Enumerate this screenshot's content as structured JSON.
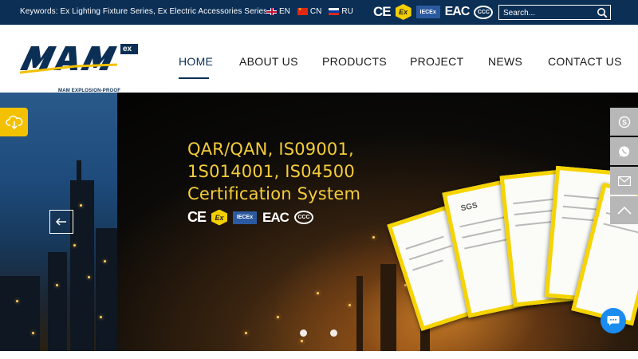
{
  "topbar": {
    "keywords": "Keywords: Ex Lighting Fixture Series, Ex Electric Accessories Series",
    "languages": [
      {
        "code": "EN",
        "flag": "uk-flag-icon"
      },
      {
        "code": "CN",
        "flag": "china-flag-icon"
      },
      {
        "code": "RU",
        "flag": "russia-flag-icon"
      }
    ],
    "certs": {
      "ce": "CE",
      "ex": "Ex",
      "iec": "IECEx",
      "eac": "EAC",
      "ccc": "CCC"
    },
    "search": {
      "placeholder": "Search...",
      "icon": "search-icon"
    }
  },
  "header": {
    "logo": {
      "text": "MAM",
      "badge": "ex",
      "subtitle": "MAM  EXPLOSION-PROOF"
    },
    "nav": [
      {
        "label": "HOME",
        "active": true
      },
      {
        "label": "ABOUT US",
        "active": false
      },
      {
        "label": "PRODUCTS",
        "active": false
      },
      {
        "label": "PROJECT",
        "active": false
      },
      {
        "label": "NEWS",
        "active": false
      },
      {
        "label": "CONTACT US",
        "active": false
      }
    ]
  },
  "banner": {
    "headline_line1": "QAR/QAN, IS09001,",
    "headline_line2": "1S014001, IS04500",
    "headline_line3": "Certification System",
    "paper_brand": "SGS",
    "dots": [
      true,
      false,
      true
    ]
  },
  "colors": {
    "navy": "#0b2f55",
    "gold": "#f4cc3a",
    "yellow": "#f3c100",
    "chat_blue": "#1a8cf0"
  },
  "side_buttons": [
    "skype-icon",
    "whatsapp-icon",
    "email-icon",
    "back-to-top-icon"
  ]
}
